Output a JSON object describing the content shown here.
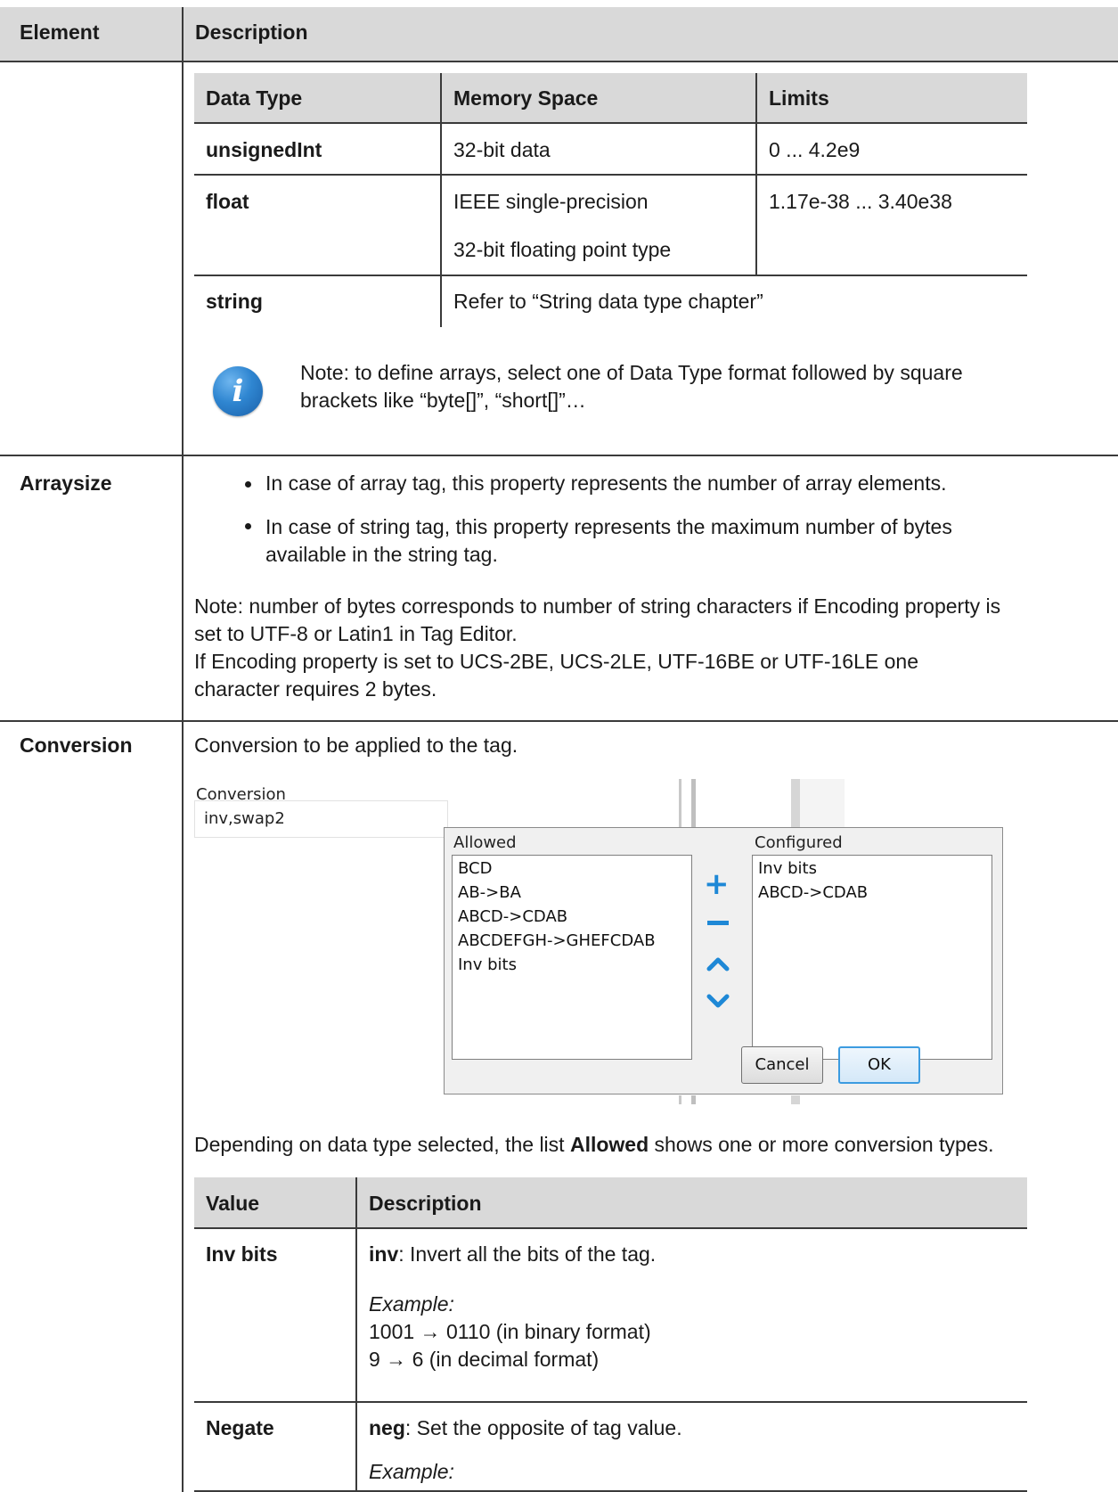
{
  "main_table": {
    "header": {
      "element": "Element",
      "description": "Description"
    }
  },
  "datatype_table": {
    "headers": [
      "Data Type",
      "Memory Space",
      "Limits"
    ],
    "rows": [
      {
        "type": "unsignedInt",
        "memory": "32-bit data",
        "limits": "0 ... 4.2e9"
      },
      {
        "type": "float",
        "memory_line1": "IEEE single-precision",
        "memory_line2": "32-bit floating point type",
        "limits": "1.17e-38 ... 3.40e38"
      },
      {
        "type": "string",
        "memory": "Refer to “String data type chapter”"
      }
    ]
  },
  "note": {
    "icon": "info-icon",
    "line1": "Note: to define arrays, select one of Data Type format followed by square",
    "line2": "brackets like “byte[]”, “short[]”…"
  },
  "arraysize": {
    "label": "Arraysize",
    "bullet1": "In case of array tag, this property represents the number of array elements.",
    "bullet2_line1": "In case of string tag, this property represents the maximum number of bytes",
    "bullet2_line2": "available in the string tag.",
    "note_line1": "Note: number of bytes corresponds to number of string characters if Encoding property is",
    "note_line2": "set to UTF-8 or Latin1 in Tag Editor.",
    "note_line3": "If Encoding property is set to UCS-2BE, UCS-2LE, UTF-16BE or UTF-16LE one",
    "note_line4": "character requires 2 bytes."
  },
  "conversion": {
    "label": "Conversion",
    "intro": "Conversion to be applied to the tag.",
    "screenshot": {
      "field_label": "Conversion",
      "field_value": "inv,swap2",
      "allowed_label": "Allowed",
      "configured_label": "Configured",
      "allowed_items": [
        "BCD",
        "AB->BA",
        "ABCD->CDAB",
        "ABCDEFGH->GHEFCDAB",
        "Inv bits"
      ],
      "configured_items": [
        "Inv bits",
        "ABCD->CDAB"
      ],
      "cancel_label": "Cancel",
      "ok_label": "OK"
    },
    "depending_before": "Depending on data type selected, the list ",
    "depending_bold": "Allowed",
    "depending_after": " shows one or more conversion types."
  },
  "value_table": {
    "headers": [
      "Value",
      "Description"
    ],
    "rows": [
      {
        "value": "Inv bits",
        "keyword": "inv",
        "text": ": Invert all the bits of the tag.",
        "example_label": "Example:",
        "example_line1": "1001 → 0110 (in binary format)",
        "example_line2": "9 → 6 (in decimal format)"
      },
      {
        "value": "Negate",
        "keyword": "neg",
        "text": ": Set the opposite of tag value.",
        "example_label": "Example:"
      }
    ]
  }
}
